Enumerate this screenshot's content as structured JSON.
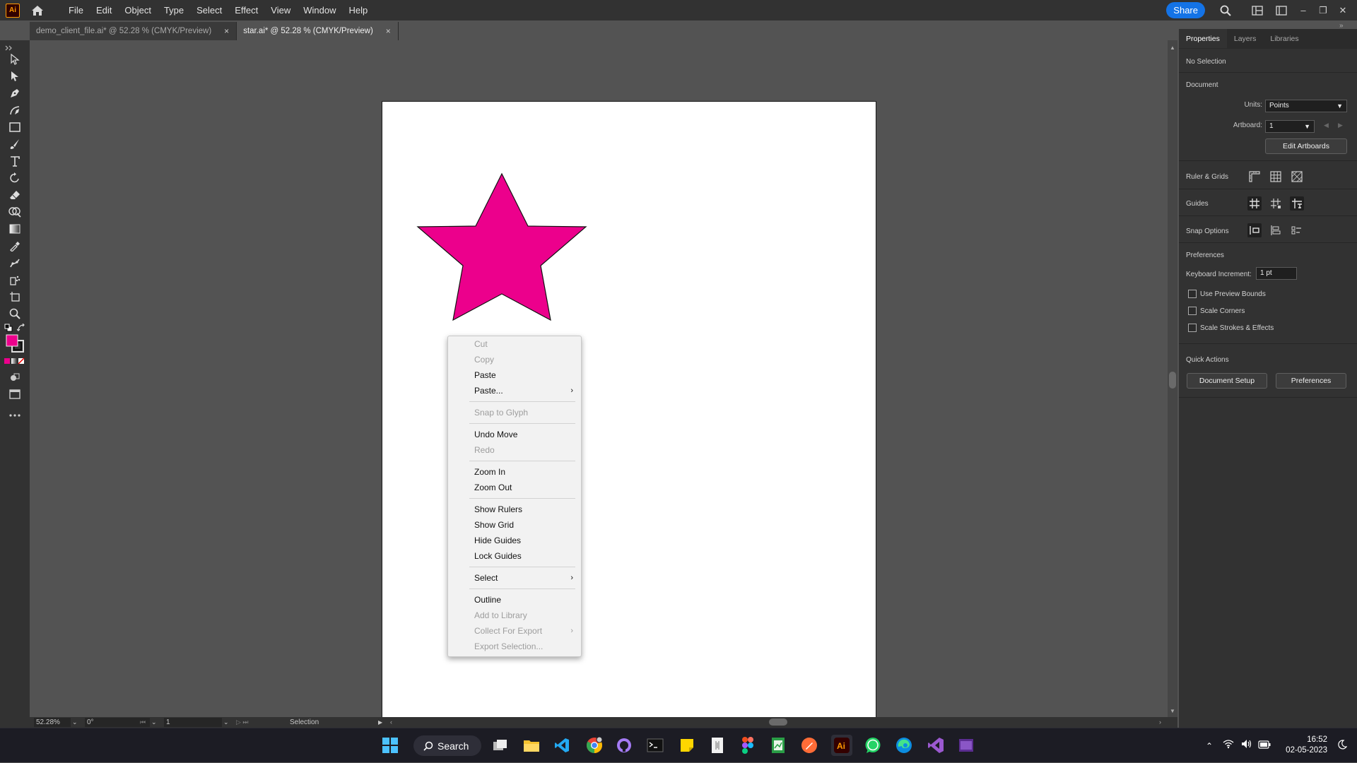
{
  "app": {
    "logo_text": "Ai"
  },
  "menubar": {
    "items": [
      "File",
      "Edit",
      "Object",
      "Type",
      "Select",
      "Effect",
      "View",
      "Window",
      "Help"
    ],
    "share_label": "Share"
  },
  "tabs": [
    {
      "label": "demo_client_file.ai* @ 52.28 % (CMYK/Preview)",
      "close": "×",
      "active": false
    },
    {
      "label": "star.ai* @ 52.28 % (CMYK/Preview)",
      "close": "×",
      "active": true
    }
  ],
  "artboard": {
    "star_fill": "#ec008c"
  },
  "colors": {
    "fill": "#ec008c",
    "accent": "#1473e6"
  },
  "context_menu": {
    "cut": "Cut",
    "copy": "Copy",
    "paste": "Paste",
    "paste_more": "Paste...",
    "snap_to_glyph": "Snap to Glyph",
    "undo_move": "Undo Move",
    "redo": "Redo",
    "zoom_in": "Zoom In",
    "zoom_out": "Zoom Out",
    "show_rulers": "Show Rulers",
    "show_grid": "Show Grid",
    "hide_guides": "Hide Guides",
    "lock_guides": "Lock Guides",
    "select": "Select",
    "outline": "Outline",
    "add_to_library": "Add to Library",
    "collect_for_export": "Collect For Export",
    "export_selection": "Export Selection...",
    "submenu_arrow": "›"
  },
  "status": {
    "zoom": "52.28%",
    "rotation": "0°",
    "artboard": "1",
    "tool": "Selection"
  },
  "panel": {
    "tabs": [
      "Properties",
      "Layers",
      "Libraries"
    ],
    "selection": "No Selection",
    "document_heading": "Document",
    "units_label": "Units:",
    "units_value": "Points",
    "artboard_label": "Artboard:",
    "artboard_value": "1",
    "edit_artboards": "Edit Artboards",
    "rulers_grids": "Ruler & Grids",
    "guides": "Guides",
    "snap_options": "Snap Options",
    "preferences_heading": "Preferences",
    "keyboard_increment_label": "Keyboard Increment:",
    "keyboard_increment_value": "1 pt",
    "use_preview_bounds": "Use Preview Bounds",
    "scale_corners": "Scale Corners",
    "scale_strokes": "Scale Strokes & Effects",
    "quick_actions": "Quick Actions",
    "document_setup": "Document Setup",
    "preferences_btn": "Preferences"
  },
  "taskbar": {
    "search_label": "Search",
    "time": "16:52",
    "date": "02-05-2023"
  }
}
